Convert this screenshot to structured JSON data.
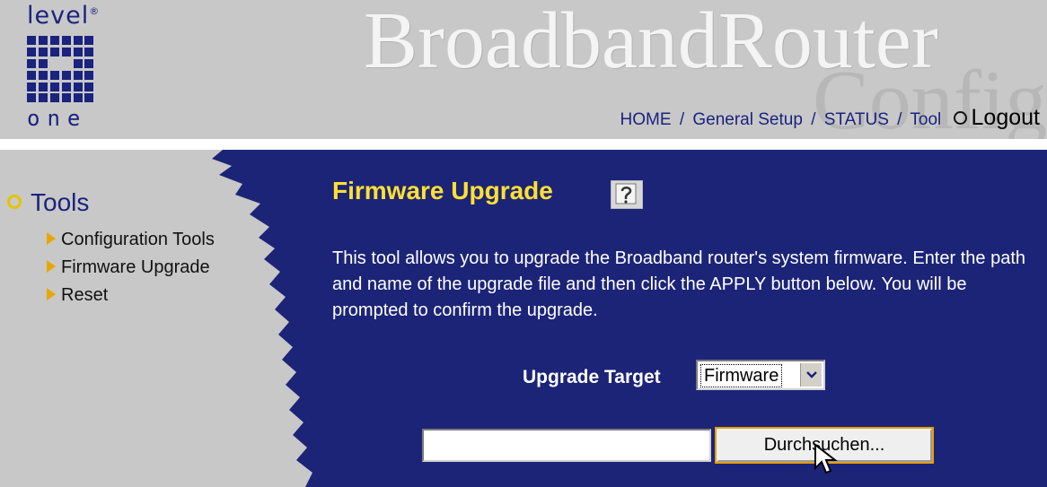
{
  "header": {
    "logo_top": "level",
    "logo_mark": "®",
    "logo_bottom": "one",
    "brand_title": "BroadbandRouter",
    "brand_sub": "Config",
    "nav": {
      "home": "HOME",
      "general_setup": "General Setup",
      "status": "STATUS",
      "tool": "Tool",
      "logout": "Logout",
      "separator": "/"
    }
  },
  "sidebar": {
    "title": "Tools",
    "items": [
      {
        "label": "Configuration Tools"
      },
      {
        "label": "Firmware Upgrade"
      },
      {
        "label": "Reset"
      }
    ]
  },
  "main": {
    "title": "Firmware Upgrade",
    "help_icon": "help-icon",
    "description": "This tool allows you to upgrade the Broadband router's system firmware. Enter the path and name of the upgrade file and then click the APPLY button below. You will be prompted to confirm the upgrade.",
    "upgrade_target_label": "Upgrade Target",
    "upgrade_target_value": "Firmware",
    "file_path_value": "",
    "browse_label": "Durchsuchen..."
  },
  "colors": {
    "header_bg": "#c8c8c8",
    "main_bg": "#1c2477",
    "title_yellow": "#ffe033",
    "nav_blue": "#1a237e",
    "accent_orange": "#e6a800"
  }
}
